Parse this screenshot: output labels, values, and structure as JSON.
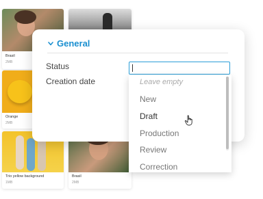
{
  "assets": [
    {
      "name": "Brasil",
      "size": "2MB"
    },
    {
      "name": "",
      "size": ""
    },
    {
      "name": "Orange",
      "size": "2MB"
    },
    {
      "name": "Trio yellow background",
      "size": "1MB"
    },
    {
      "name": "Brasil",
      "size": "2MB"
    }
  ],
  "card": {
    "section_title": "General",
    "fields": {
      "status_label": "Status",
      "creation_date_label": "Creation date",
      "status_value": ""
    }
  },
  "dropdown": {
    "options": [
      "Leave empty",
      "New",
      "Draft",
      "Production",
      "Review",
      "Correction"
    ],
    "hovered": "Draft"
  },
  "colors": {
    "accent": "#1a8fd0",
    "input_focus_border": "#2a9ed8"
  },
  "icons": {
    "section_toggle": "chevron-down-icon",
    "pointer": "hand-cursor-icon"
  }
}
